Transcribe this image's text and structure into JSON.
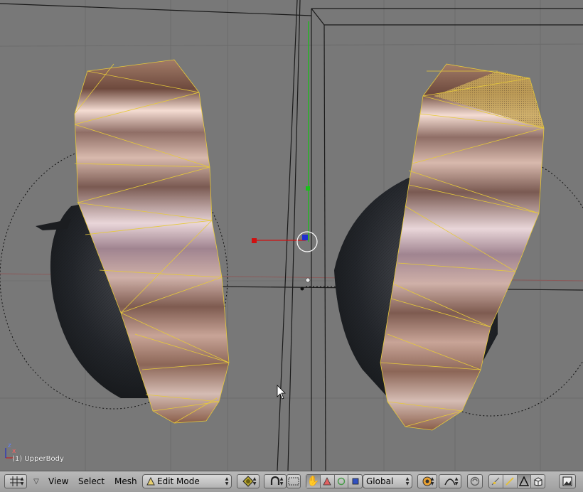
{
  "viewport": {
    "object_name": "(1) UpperBody",
    "axis_labels": {
      "x": "x",
      "z": "z"
    }
  },
  "header": {
    "menus": [
      "View",
      "Select",
      "Mesh"
    ],
    "mode_select": {
      "value": "Edit Mode"
    },
    "orientation_select": {
      "value": "Global"
    }
  },
  "colors": {
    "viewport_bg": "#787878",
    "grid": "#6b6b6b",
    "mesh_edges": "#e6c93a",
    "header_bg": "#a8a8a8",
    "axis_x": "#d01010",
    "axis_y": "#10c010",
    "axis_z": "#1020d0"
  },
  "icons": {
    "editor_type": "grid-icon",
    "draw_type": "solid-sphere-icon",
    "pivot": "pivot-icon",
    "layer": "layers-icon",
    "manipulator": "hand-icon",
    "proportional": "proportional-edit-icon",
    "snap": "magnet-icon",
    "select_modes": [
      "vertex-select-icon",
      "edge-select-icon",
      "face-select-icon",
      "occlude-icon"
    ],
    "render": "render-icon"
  }
}
